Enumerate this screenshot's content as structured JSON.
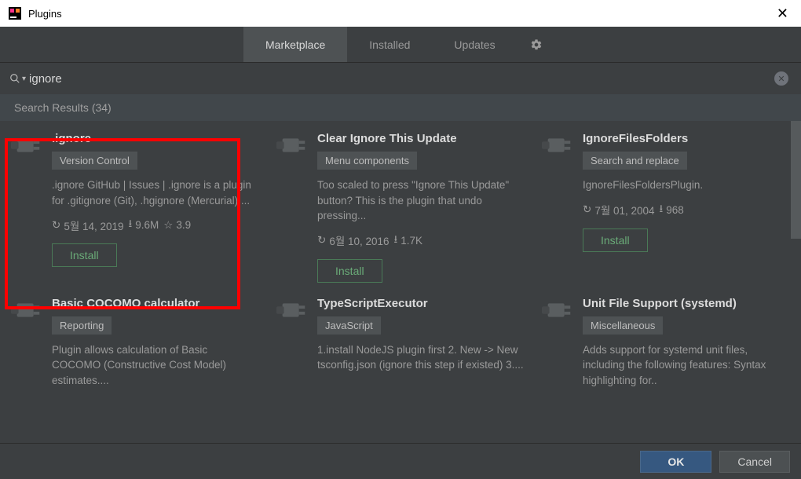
{
  "window": {
    "title": "Plugins"
  },
  "tabs": {
    "marketplace": "Marketplace",
    "installed": "Installed",
    "updates": "Updates"
  },
  "search": {
    "value": "ignore",
    "results_label": "Search Results (34)"
  },
  "buttons": {
    "ok": "OK",
    "cancel": "Cancel",
    "install": "Install"
  },
  "plugins": {
    "p1": {
      "title": ".ignore",
      "category": "Version Control",
      "desc": ".ignore GitHub | Issues | .ignore is a plugin for .gitignore (Git), .hgignore (Mercurial),...",
      "date": "5월 14, 2019",
      "downloads": "9.6M",
      "rating": "3.9"
    },
    "p2": {
      "title": "Clear Ignore This Update",
      "category": "Menu components",
      "desc": "Too scaled to press \"Ignore This Update\" button? This is the plugin that undo pressing...",
      "date": "6월 10, 2016",
      "downloads": "1.7K"
    },
    "p3": {
      "title": "IgnoreFilesFolders",
      "category": "Search and replace",
      "desc": "IgnoreFilesFoldersPlugin.",
      "date": "7월 01, 2004",
      "downloads": "968"
    },
    "p4": {
      "title": "Basic COCOMO calculator",
      "category": "Reporting",
      "desc": "Plugin allows calculation of Basic COCOMO (Constructive Cost Model) estimates...."
    },
    "p5": {
      "title": "TypeScriptExecutor",
      "category": "JavaScript",
      "desc": "1.install NodeJS plugin first 2. New -> New tsconfig.json (ignore this step if existed) 3...."
    },
    "p6": {
      "title": "Unit File Support (systemd)",
      "category": "Miscellaneous",
      "desc": "Adds support for systemd unit files, including the following features: Syntax highlighting for.."
    }
  }
}
